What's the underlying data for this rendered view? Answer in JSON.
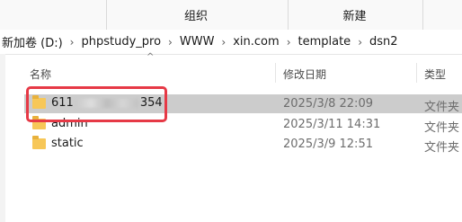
{
  "ribbon": {
    "organize_label": "组织",
    "new_label": "新建"
  },
  "address": {
    "crumbs": [
      "新加卷 (D:)",
      "phpstudy_pro",
      "WWW",
      "xin.com",
      "template",
      "dsn2"
    ],
    "separator": "›"
  },
  "columns": {
    "name": "名称",
    "date": "修改日期",
    "type": "类型",
    "sort_indicator": "^"
  },
  "files": [
    {
      "name_prefix": "611",
      "name_suffix": "354",
      "date": "2025/3/8 22:09",
      "type": "文件夹",
      "selected": true,
      "icon": "folder-icon"
    },
    {
      "name": "admin",
      "date": "2025/3/11 14:31",
      "type": "文件夹",
      "selected": false,
      "icon": "folder-icon"
    },
    {
      "name": "static",
      "date": "2025/3/9 12:51",
      "type": "文件夹",
      "selected": false,
      "icon": "folder-icon"
    }
  ],
  "colors": {
    "highlight": "#e63946",
    "folder": "#f7c758",
    "selection": "#cccccc"
  }
}
